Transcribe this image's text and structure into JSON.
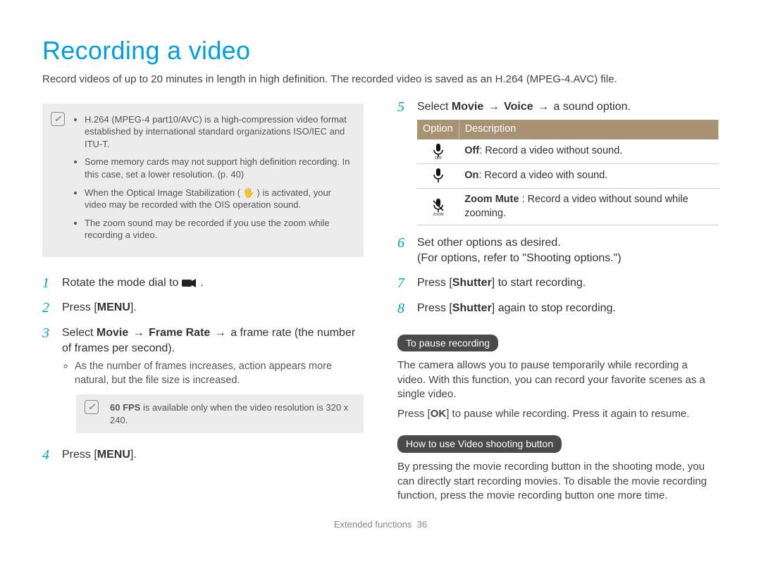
{
  "title": "Recording a video",
  "intro": "Record videos of up to 20 minutes in length in high definition. The recorded video is saved as an H.264 (MPEG-4.AVC) file.",
  "infoBox": {
    "items": [
      "H.264 (MPEG-4 part10/AVC) is a high-compression video format established by international standard organizations ISO/IEC and ITU-T.",
      "Some memory cards may not support high definition recording. In this case, set a lower resolution. (p. 40)",
      "When the Optical Image Stabilization ( 🖐 ) is activated, your video may be recorded with the OIS operation sound.",
      "The zoom sound may be recorded if you use the zoom while recording a video."
    ]
  },
  "left": {
    "step1": {
      "pre": "Rotate the mode dial to ",
      "post": "."
    },
    "step2": {
      "pre": "Press [",
      "key": "MENU",
      "post": "]."
    },
    "step3": {
      "pre": "Select ",
      "b1": "Movie",
      "arr1": " → ",
      "b2": "Frame Rate",
      "arr2": " → ",
      "tail": "a frame rate (the number of frames per second).",
      "bullet": "As the number of frames increases, action appears more natural, but the file size is increased."
    },
    "fpsNote": {
      "b": "60 FPS",
      "text": " is available only when the video resolution is 320 x 240."
    },
    "step4": {
      "pre": "Press [",
      "key": "MENU",
      "post": "]."
    }
  },
  "right": {
    "step5": {
      "pre": "Select ",
      "b1": "Movie",
      "arr1": " → ",
      "b2": "Voice",
      "arr2": " → ",
      "tail": "a sound option."
    },
    "table": {
      "h1": "Option",
      "h2": "Description",
      "rows": [
        {
          "label": "Off",
          "desc": ": Record a video without sound."
        },
        {
          "label": "On",
          "desc": ": Record a video with sound."
        },
        {
          "label": "Zoom Mute",
          "desc": " : Record a video without sound while zooming."
        }
      ]
    },
    "step6": {
      "l1": "Set other options as desired.",
      "l2": "(For options, refer to \"Shooting options.\")"
    },
    "step7": {
      "pre": "Press [",
      "b": "Shutter",
      "post": "] to start recording."
    },
    "step8": {
      "pre": "Press [",
      "b": "Shutter",
      "post": "] again to stop recording."
    },
    "pause": {
      "heading": "To pause recording",
      "p1": "The camera allows you to pause temporarily while recording a video. With this function, you can record your favorite scenes as a single video.",
      "p2a": "Press [",
      "ok": "OK",
      "p2b": "] to pause while recording. Press it again to resume."
    },
    "howto": {
      "heading": "How to use Video shooting button",
      "p": "By pressing the movie recording button in the shooting mode, you can directly start recording movies. To disable the movie recording function, press the movie recording button one more time."
    }
  },
  "footer": {
    "section": "Extended functions",
    "page": "36"
  }
}
